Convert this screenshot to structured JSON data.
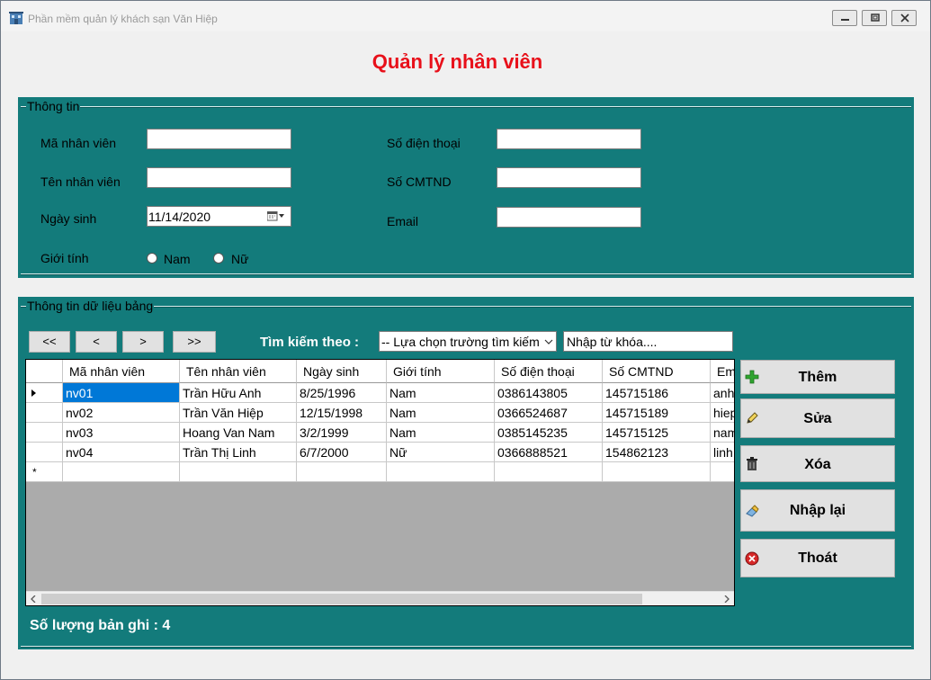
{
  "window": {
    "title": "Phần mềm quản lý khách sạn Văn Hiệp",
    "controls": [
      "minimize-icon",
      "restore-icon",
      "close-icon"
    ]
  },
  "heading": "Quản lý nhân viên",
  "colors": {
    "panel": "#137b7b",
    "heading": "#e8101a",
    "selection": "#0078d7"
  },
  "info": {
    "legend": "Thông tin",
    "ma_label": "Mã nhân viên",
    "ten_label": "Tên nhân viên",
    "ngaysinh_label": "Ngày sinh",
    "ngaysinh_value": "11/14/2020",
    "gioitinh_label": "Giới tính",
    "nam_label": "Nam",
    "nu_label": "Nữ",
    "sdt_label": "Số điện thoại",
    "cmtnd_label": "Số CMTND",
    "email_label": "Email"
  },
  "table_panel": {
    "legend": "Thông tin dữ liệu  bảng",
    "nav": [
      "<<",
      "<",
      ">",
      ">>"
    ],
    "search_label": "Tìm kiếm theo :",
    "search_field_selected": "-- Lựa chọn trường tìm kiếm",
    "keyword_value": "Nhập từ khóa....",
    "columns": [
      "Mã nhân viên",
      "Tên nhân viên",
      "Ngày sinh",
      "Giới tính",
      "Số điện thoại",
      "Số CMTND",
      "Email"
    ],
    "rows": [
      [
        "nv01",
        "Trần Hữu Anh",
        "8/25/1996",
        "Nam",
        "0386143805",
        "145715186",
        "anh"
      ],
      [
        "nv02",
        "Trần Văn Hiệp",
        "12/15/1998",
        "Nam",
        "0366524687",
        "145715189",
        "hiep"
      ],
      [
        "nv03",
        "Hoang Van Nam",
        "3/2/1999",
        "Nam",
        "0385145235",
        "145715125",
        "nam"
      ],
      [
        "nv04",
        "Trần Thị Linh",
        "6/7/2000",
        "Nữ",
        "0366888521",
        "154862123",
        "linh"
      ]
    ],
    "new_row_marker": "*",
    "count_label": "Số lượng bản ghi : 4"
  },
  "actions": {
    "them": "Thêm",
    "sua": "Sửa",
    "xoa": "Xóa",
    "nhaplai": "Nhập lại",
    "thoat": "Thoát"
  }
}
